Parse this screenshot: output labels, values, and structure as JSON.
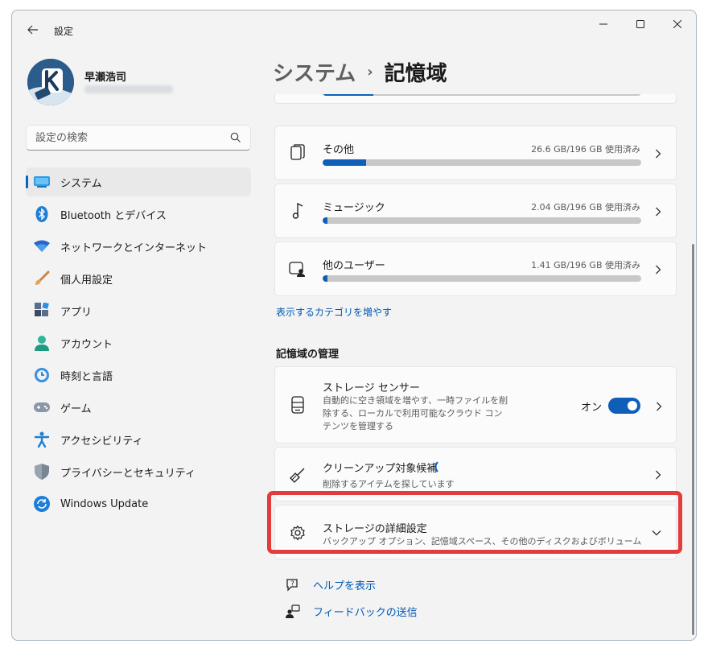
{
  "window": {
    "title": "設定"
  },
  "profile": {
    "name": "早瀬浩司"
  },
  "search": {
    "placeholder": "設定の検索"
  },
  "sidebar": {
    "items": [
      {
        "label": "システム",
        "icon": "system-icon",
        "selected": true
      },
      {
        "label": "Bluetooth とデバイス",
        "icon": "bluetooth-icon"
      },
      {
        "label": "ネットワークとインターネット",
        "icon": "wifi-icon"
      },
      {
        "label": "個人用設定",
        "icon": "brush-icon"
      },
      {
        "label": "アプリ",
        "icon": "apps-icon"
      },
      {
        "label": "アカウント",
        "icon": "account-icon"
      },
      {
        "label": "時刻と言語",
        "icon": "clock-globe-icon"
      },
      {
        "label": "ゲーム",
        "icon": "gamepad-icon"
      },
      {
        "label": "アクセシビリティ",
        "icon": "accessibility-icon"
      },
      {
        "label": "プライバシーとセキュリティ",
        "icon": "shield-icon"
      },
      {
        "label": "Windows Update",
        "icon": "update-icon"
      }
    ]
  },
  "breadcrumb": {
    "parent": "システム",
    "separator": "›",
    "current": "記憶域"
  },
  "storage": {
    "top_partial": {
      "used_fraction": 0.16
    },
    "categories": [
      {
        "label": "その他",
        "usage": "26.6 GB/196 GB 使用済み",
        "used_fraction": 0.136
      },
      {
        "label": "ミュージック",
        "usage": "2.04 GB/196 GB 使用済み",
        "used_fraction": 0.0104
      },
      {
        "label": "他のユーザー",
        "usage": "1.41 GB/196 GB 使用済み",
        "used_fraction": 0.0072
      }
    ],
    "show_more_link": "表示するカテゴリを増やす"
  },
  "management": {
    "section_title": "記憶域の管理",
    "storage_sense": {
      "title": "ストレージ センサー",
      "description": "自動的に空き領域を増やす、一時ファイルを削除する、ローカルで利用可能なクラウド コンテンツを管理する",
      "toggle_label": "オン",
      "toggle_on": true
    },
    "cleanup": {
      "title": "クリーンアップ対象候補",
      "description": "削除するアイテムを探しています"
    },
    "advanced": {
      "title": "ストレージの詳細設定",
      "description": "バックアップ オプション、記憶域スペース、その他のディスクおよびボリューム"
    }
  },
  "footer": {
    "help": "ヘルプを表示",
    "feedback": "フィードバックの送信"
  },
  "colors": {
    "accent": "#0f5fb9",
    "link": "#0058b5",
    "highlight": "#e23c3c"
  }
}
